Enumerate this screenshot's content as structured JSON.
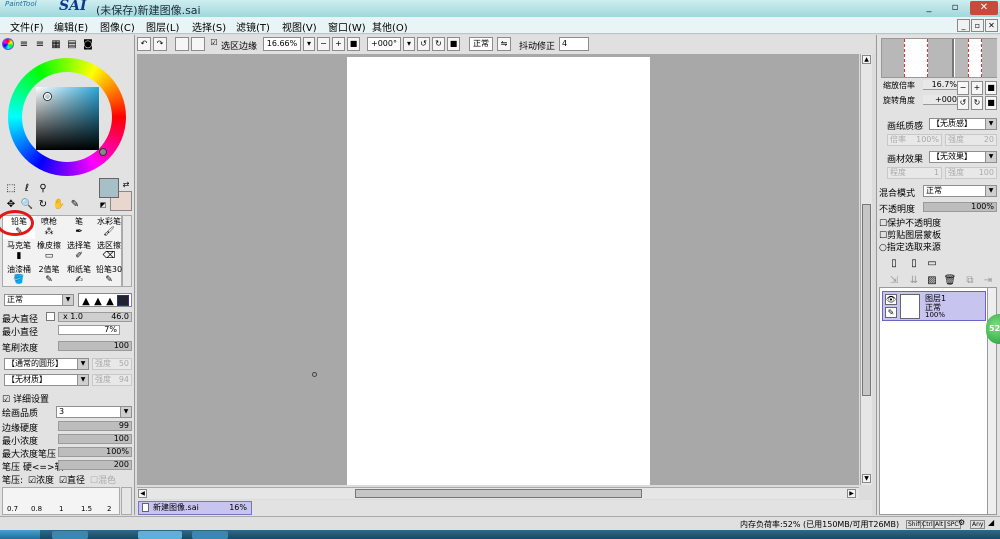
{
  "app": {
    "title": "(未保存)新建图像.sai",
    "logo_small": "PaintTool",
    "logo_big": "SAI",
    "window_buttons": [
      "_",
      "▫",
      "✕"
    ]
  },
  "menu": [
    "文件(F)",
    "编辑(E)",
    "图像(C)",
    "图层(L)",
    "选择(S)",
    "滤镜(T)",
    "视图(V)",
    "窗口(W)",
    "其他(O)"
  ],
  "toolbar": {
    "selection_edge_label": "选区边缘",
    "zoom": "16.66%",
    "rotation": "+000°",
    "blend": "正常",
    "stabilizer_label": "抖动修正",
    "stabilizer_value": "4"
  },
  "brush_tools": [
    {
      "label": "铅笔",
      "active": true
    },
    {
      "label": "喷枪"
    },
    {
      "label": "笔"
    },
    {
      "label": "水彩笔"
    },
    {
      "label": "马克笔"
    },
    {
      "label": "橡皮擦"
    },
    {
      "label": "选择笔"
    },
    {
      "label": "选区擦"
    },
    {
      "label": "油漆桶"
    },
    {
      "label": "2值笔"
    },
    {
      "label": "和纸笔"
    },
    {
      "label": "铅笔30"
    }
  ],
  "brush": {
    "mode": "正常",
    "max_size_label": "最大直径",
    "max_size_mult": "x 1.0",
    "max_size_value": "46.0",
    "min_size_label": "最小直径",
    "min_size_value": "7%",
    "density_label": "笔刷浓度",
    "density_value": "100",
    "shape": "【通常的圆形】",
    "shape_intensity_label": "强度",
    "shape_intensity_value": "50",
    "texture": "【无材质】",
    "texture_intensity_label": "强度",
    "texture_intensity_value": "94",
    "details_label": "详细设置",
    "quality_label": "绘画品质",
    "quality_value": "3",
    "edge_hardness_label": "边缘硬度",
    "edge_hardness_value": "99",
    "min_density_label": "最小浓度",
    "min_density_value": "100",
    "max_density_pressure_label": "最大浓度笔压",
    "max_density_pressure_value": "100%",
    "pressure_label": "笔压 硬<=>软",
    "pressure_value": "200",
    "pressure_opts_label": "笔压:",
    "pressure_density": "浓度",
    "pressure_size": "直径",
    "pressure_blend": "混色",
    "sizes": [
      "0.7",
      "0.8",
      "1",
      "1.5",
      "2"
    ]
  },
  "navigator": {
    "zoom_label": "缩放倍率",
    "zoom_value": "16.7%",
    "angle_label": "旋转角度",
    "angle_value": "+000"
  },
  "layer_props": {
    "paper_texture_label": "画纸质感",
    "paper_texture_value": "【无质感】",
    "paper_mult_label": "倍率",
    "paper_mult_value": "100%",
    "paper_strength_label": "强度",
    "paper_strength_value": "20",
    "effect_label": "画材效果",
    "effect_value": "【无效果】",
    "effect_degree_label": "程度",
    "effect_degree_value": "1",
    "effect_strength_label": "强度",
    "effect_strength_value": "100",
    "blend_label": "混合模式",
    "blend_value": "正常",
    "opacity_label": "不透明度",
    "opacity_value": "100%",
    "protect_opacity": "保护不透明度",
    "clipping_group": "剪贴图层蒙板",
    "selection_source": "指定选取来源"
  },
  "layers": [
    {
      "name": "图层1",
      "mode": "正常",
      "opacity": "100%"
    }
  ],
  "document_tab": {
    "name": "新建图像.sai",
    "zoom": "16%"
  },
  "status": {
    "memory": "内存负荷率:52% (已用150MB/可用T26MB)",
    "keys": [
      "Shift",
      "Ctrl",
      "Alt",
      "SPC",
      "Any"
    ],
    "badge": "52"
  },
  "colors": {
    "foreground": "#a7c0c8",
    "background": "#e8d6cf",
    "layer_selected": "#c8c4f0",
    "doc_tab": "#c8c4f0",
    "highlight_circle": "#e01818"
  }
}
